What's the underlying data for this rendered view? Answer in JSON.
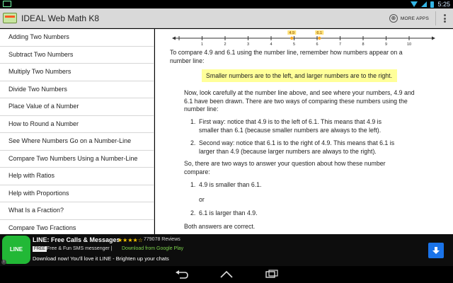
{
  "status_bar": {
    "time": "5:25"
  },
  "app": {
    "title": "IDEAL Web Math K8",
    "more_apps": "MORE APPS"
  },
  "sidebar": {
    "items": [
      "Adding Two Numbers",
      "Subtract Two Numbers",
      "Multiply Two Numbers",
      "Divide Two Numbers",
      "Place Value of a Number",
      "How to Round a Number",
      "See Where Numbers Go on a Number-Line",
      "Compare Two Numbers Using a Number-Line",
      "Help with Ratios",
      "Help with Proportions",
      "What Is a Fraction?",
      "Compare Two Fractions"
    ]
  },
  "number_line": {
    "ticks": [
      "1",
      "2",
      "3",
      "4",
      "5",
      "6",
      "7",
      "8",
      "9",
      "10"
    ],
    "marker_a": "4.9",
    "marker_b": "6.1",
    "marker_color": "#f5a623"
  },
  "content": {
    "intro": "To compare 4.9 and 6.1 using the number line, remember how numbers appear on a number line:",
    "rule": "Smaller numbers are to the left, and larger numbers are to the right.",
    "look": "Now, look carefully at the number line above, and see where your numbers, 4.9 and 6.1 have been drawn. There are two ways of comparing these numbers using the number line:",
    "ways": [
      {
        "n": "1.",
        "text": "First way: notice that 4.9 is to the left of 6.1. This means that 4.9 is smaller than 6.1 (because smaller numbers are always to the left)."
      },
      {
        "n": "2.",
        "text": "Second way: notice that 6.1 is to the right of 4.9. This means that 6.1 is larger than 4.9 (because larger numbers are always to the right)."
      }
    ],
    "answer_intro": "So, there are two ways to answer your question about how these number compare:",
    "answers": [
      {
        "n": "1.",
        "text": "4.9 is smaller than 6.1."
      },
      {
        "n": "2.",
        "text": "6.1 is larger than 4.9."
      }
    ],
    "or_word": "or",
    "conclusion": "Both answers are correct."
  },
  "ad": {
    "logo_text": "LINE",
    "title": "LINE: Free Calls & Messages",
    "stars": "★★★★☆",
    "reviews": "779078 Reviews",
    "free_badge": "FREE",
    "subtitle": "Free & Fun SMS messenger |",
    "download_text": "Download from Google Play",
    "line3": "Download now! You'll love it LINE - Brighten up your chats",
    "info": "i",
    "download_icon": "download-arrow-icon",
    "accent": "#22b836"
  },
  "colors": {
    "highlight": "#ffff99",
    "actionbar": "#d9d9d9",
    "status_icons": "#33b5e5"
  }
}
